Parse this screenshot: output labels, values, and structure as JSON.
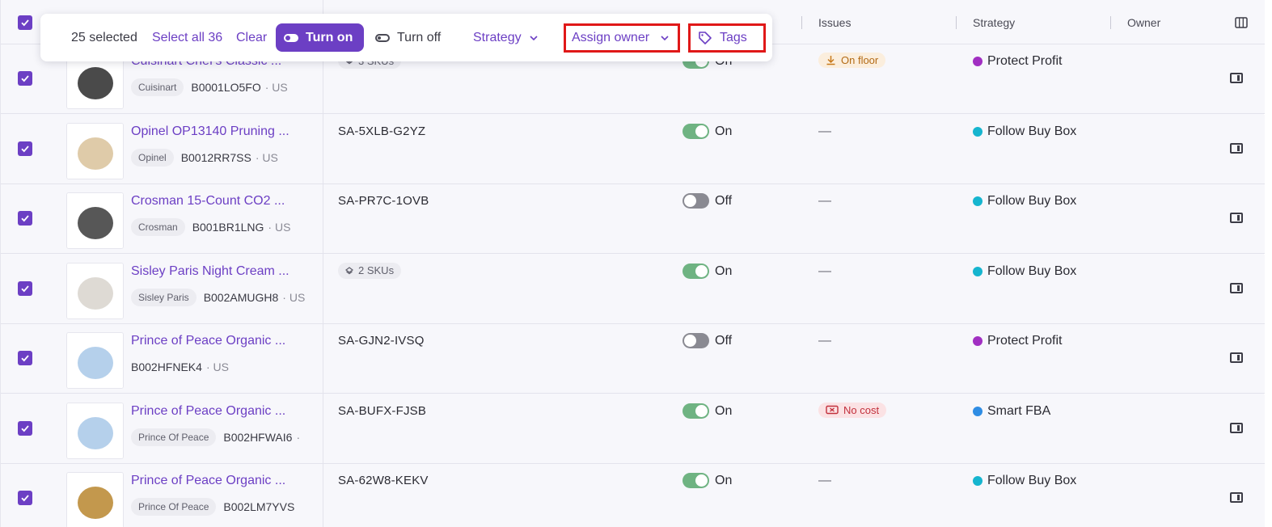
{
  "header": {
    "issues": "Issues",
    "strategy": "Strategy",
    "owner": "Owner"
  },
  "toolbar": {
    "selected": "25 selected",
    "select_all": "Select all 36",
    "clear": "Clear",
    "turn_on": "Turn on",
    "turn_off": "Turn off",
    "strategy": "Strategy",
    "assign_owner": "Assign owner",
    "tags": "Tags"
  },
  "rows": [
    {
      "title": "Cuisinart Chef's Classic ...",
      "brand": "Cuisinart",
      "asin": "B0001LO5FO",
      "region": "· US",
      "sku": "",
      "sku_pill": "3 SKUs",
      "status": "On",
      "issue": "On floor",
      "issue_type": "floor",
      "strategy": "Protect Profit",
      "strategy_color": "#a12fc2"
    },
    {
      "title": "Opinel OP13140 Pruning ...",
      "brand": "Opinel",
      "asin": "B0012RR7SS",
      "region": "· US",
      "sku": "SA-5XLB-G2YZ",
      "sku_pill": "",
      "status": "On",
      "issue": "—",
      "issue_type": "none",
      "strategy": "Follow Buy Box",
      "strategy_color": "#16b5cf"
    },
    {
      "title": "Crosman 15-Count CO2 ...",
      "brand": "Crosman",
      "asin": "B001BR1LNG",
      "region": "· US",
      "sku": "SA-PR7C-1OVB",
      "sku_pill": "",
      "status": "Off",
      "issue": "—",
      "issue_type": "none",
      "strategy": "Follow Buy Box",
      "strategy_color": "#16b5cf"
    },
    {
      "title": "Sisley Paris Night Cream ...",
      "brand": "Sisley Paris",
      "asin": "B002AMUGH8",
      "region": "· US",
      "sku": "",
      "sku_pill": "2 SKUs",
      "status": "On",
      "issue": "—",
      "issue_type": "none",
      "strategy": "Follow Buy Box",
      "strategy_color": "#16b5cf"
    },
    {
      "title": "Prince of Peace Organic ...",
      "brand": "",
      "asin": "B002HFNEK4",
      "region": "· US",
      "sku": "SA-GJN2-IVSQ",
      "sku_pill": "",
      "status": "Off",
      "issue": "—",
      "issue_type": "none",
      "strategy": "Protect Profit",
      "strategy_color": "#a12fc2"
    },
    {
      "title": "Prince of Peace Organic ...",
      "brand": "Prince Of Peace",
      "asin": "B002HFWAI6",
      "region": "·",
      "sku": "SA-BUFX-FJSB",
      "sku_pill": "",
      "status": "On",
      "issue": "No cost",
      "issue_type": "cost",
      "strategy": "Smart FBA",
      "strategy_color": "#2f8de4"
    },
    {
      "title": "Prince of Peace Organic ...",
      "brand": "Prince Of Peace",
      "asin": "B002LM7YVS",
      "region": "",
      "sku": "SA-62W8-KEKV",
      "sku_pill": "",
      "status": "On",
      "issue": "—",
      "issue_type": "none",
      "strategy": "Follow Buy Box",
      "strategy_color": "#16b5cf"
    }
  ]
}
